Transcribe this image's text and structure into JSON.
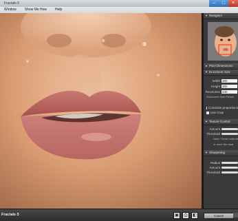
{
  "window": {
    "title": "Fractals 5",
    "buttons": {
      "minimize": "–",
      "maximize": "□",
      "close": "×"
    }
  },
  "menu": [
    "Window",
    "Show Me How",
    "Help"
  ],
  "panel": {
    "navigator": "Navigator",
    "pixel_dimensions": "Pixel Dimensions",
    "document_size": {
      "title": "Document Size",
      "width_label": "Width",
      "width_value": "300",
      "height_label": "Height",
      "height_value": "300",
      "resolution_label": "Resolution",
      "resolution_value": "240",
      "preset_label": "Document Size Preset",
      "constrain_label": "Constrain proportions",
      "crop_label": "Use Crop"
    },
    "texture_control": {
      "title": "Texture Control",
      "amount_label": "Amount",
      "threshold_label": "Threshold",
      "note_line1": "Note: These controls are",
      "note_line2": "or more the load"
    },
    "sharpening": {
      "title": "Sharpening",
      "radius_label": "Radius",
      "amount_label": "Amount",
      "threshold_label": "Threshold"
    }
  },
  "statusbar": {
    "brand": "Fractals 5",
    "cancel": "Cancel"
  },
  "icons": [
    "collapse-arrow-icon",
    "lock-icon",
    "save-icon",
    "print-icon",
    "view-icon"
  ]
}
